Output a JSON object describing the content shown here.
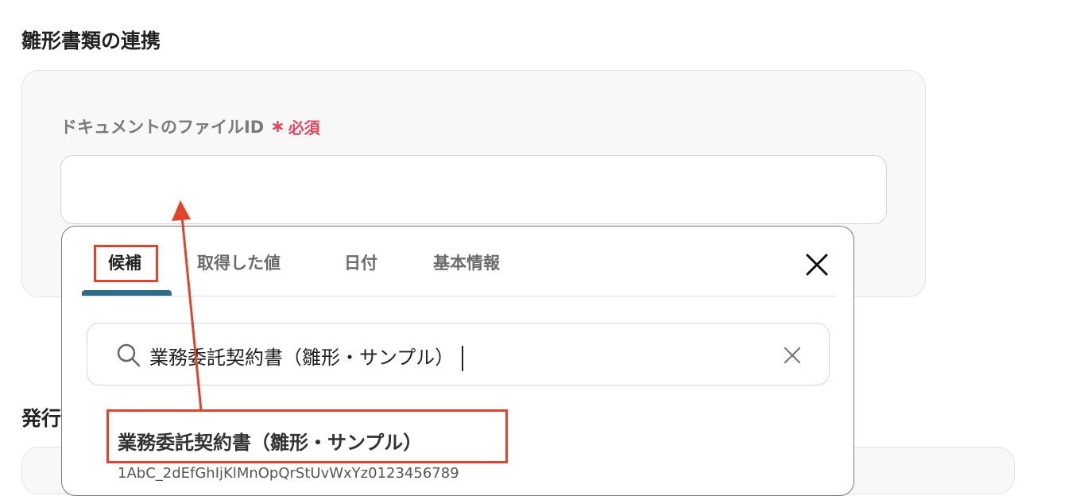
{
  "sections": {
    "template_link_title": "雛形書類の連携",
    "issue_title": "発行"
  },
  "field": {
    "label": "ドキュメントのファイルID",
    "required_mark": "∗",
    "required_text": "必須",
    "value": ""
  },
  "popup": {
    "tabs": [
      {
        "label": "候補",
        "active": true
      },
      {
        "label": "取得した値",
        "active": false
      },
      {
        "label": "日付",
        "active": false
      },
      {
        "label": "基本情報",
        "active": false
      }
    ],
    "close_icon": "close-icon",
    "search": {
      "value": "業務委託契約書（雛形・サンプル）",
      "icon": "search-icon",
      "clear_icon": "clear-icon"
    },
    "results": [
      {
        "title": "業務委託契約書（雛形・サンプル）",
        "subtitle": "1AbC_2dEfGhIjKlMnOpQrStUvWxYz0123456789"
      }
    ]
  },
  "colors": {
    "accent_tab": "#2e6b88",
    "required": "#e0475f",
    "annotation": "#e0442c"
  }
}
